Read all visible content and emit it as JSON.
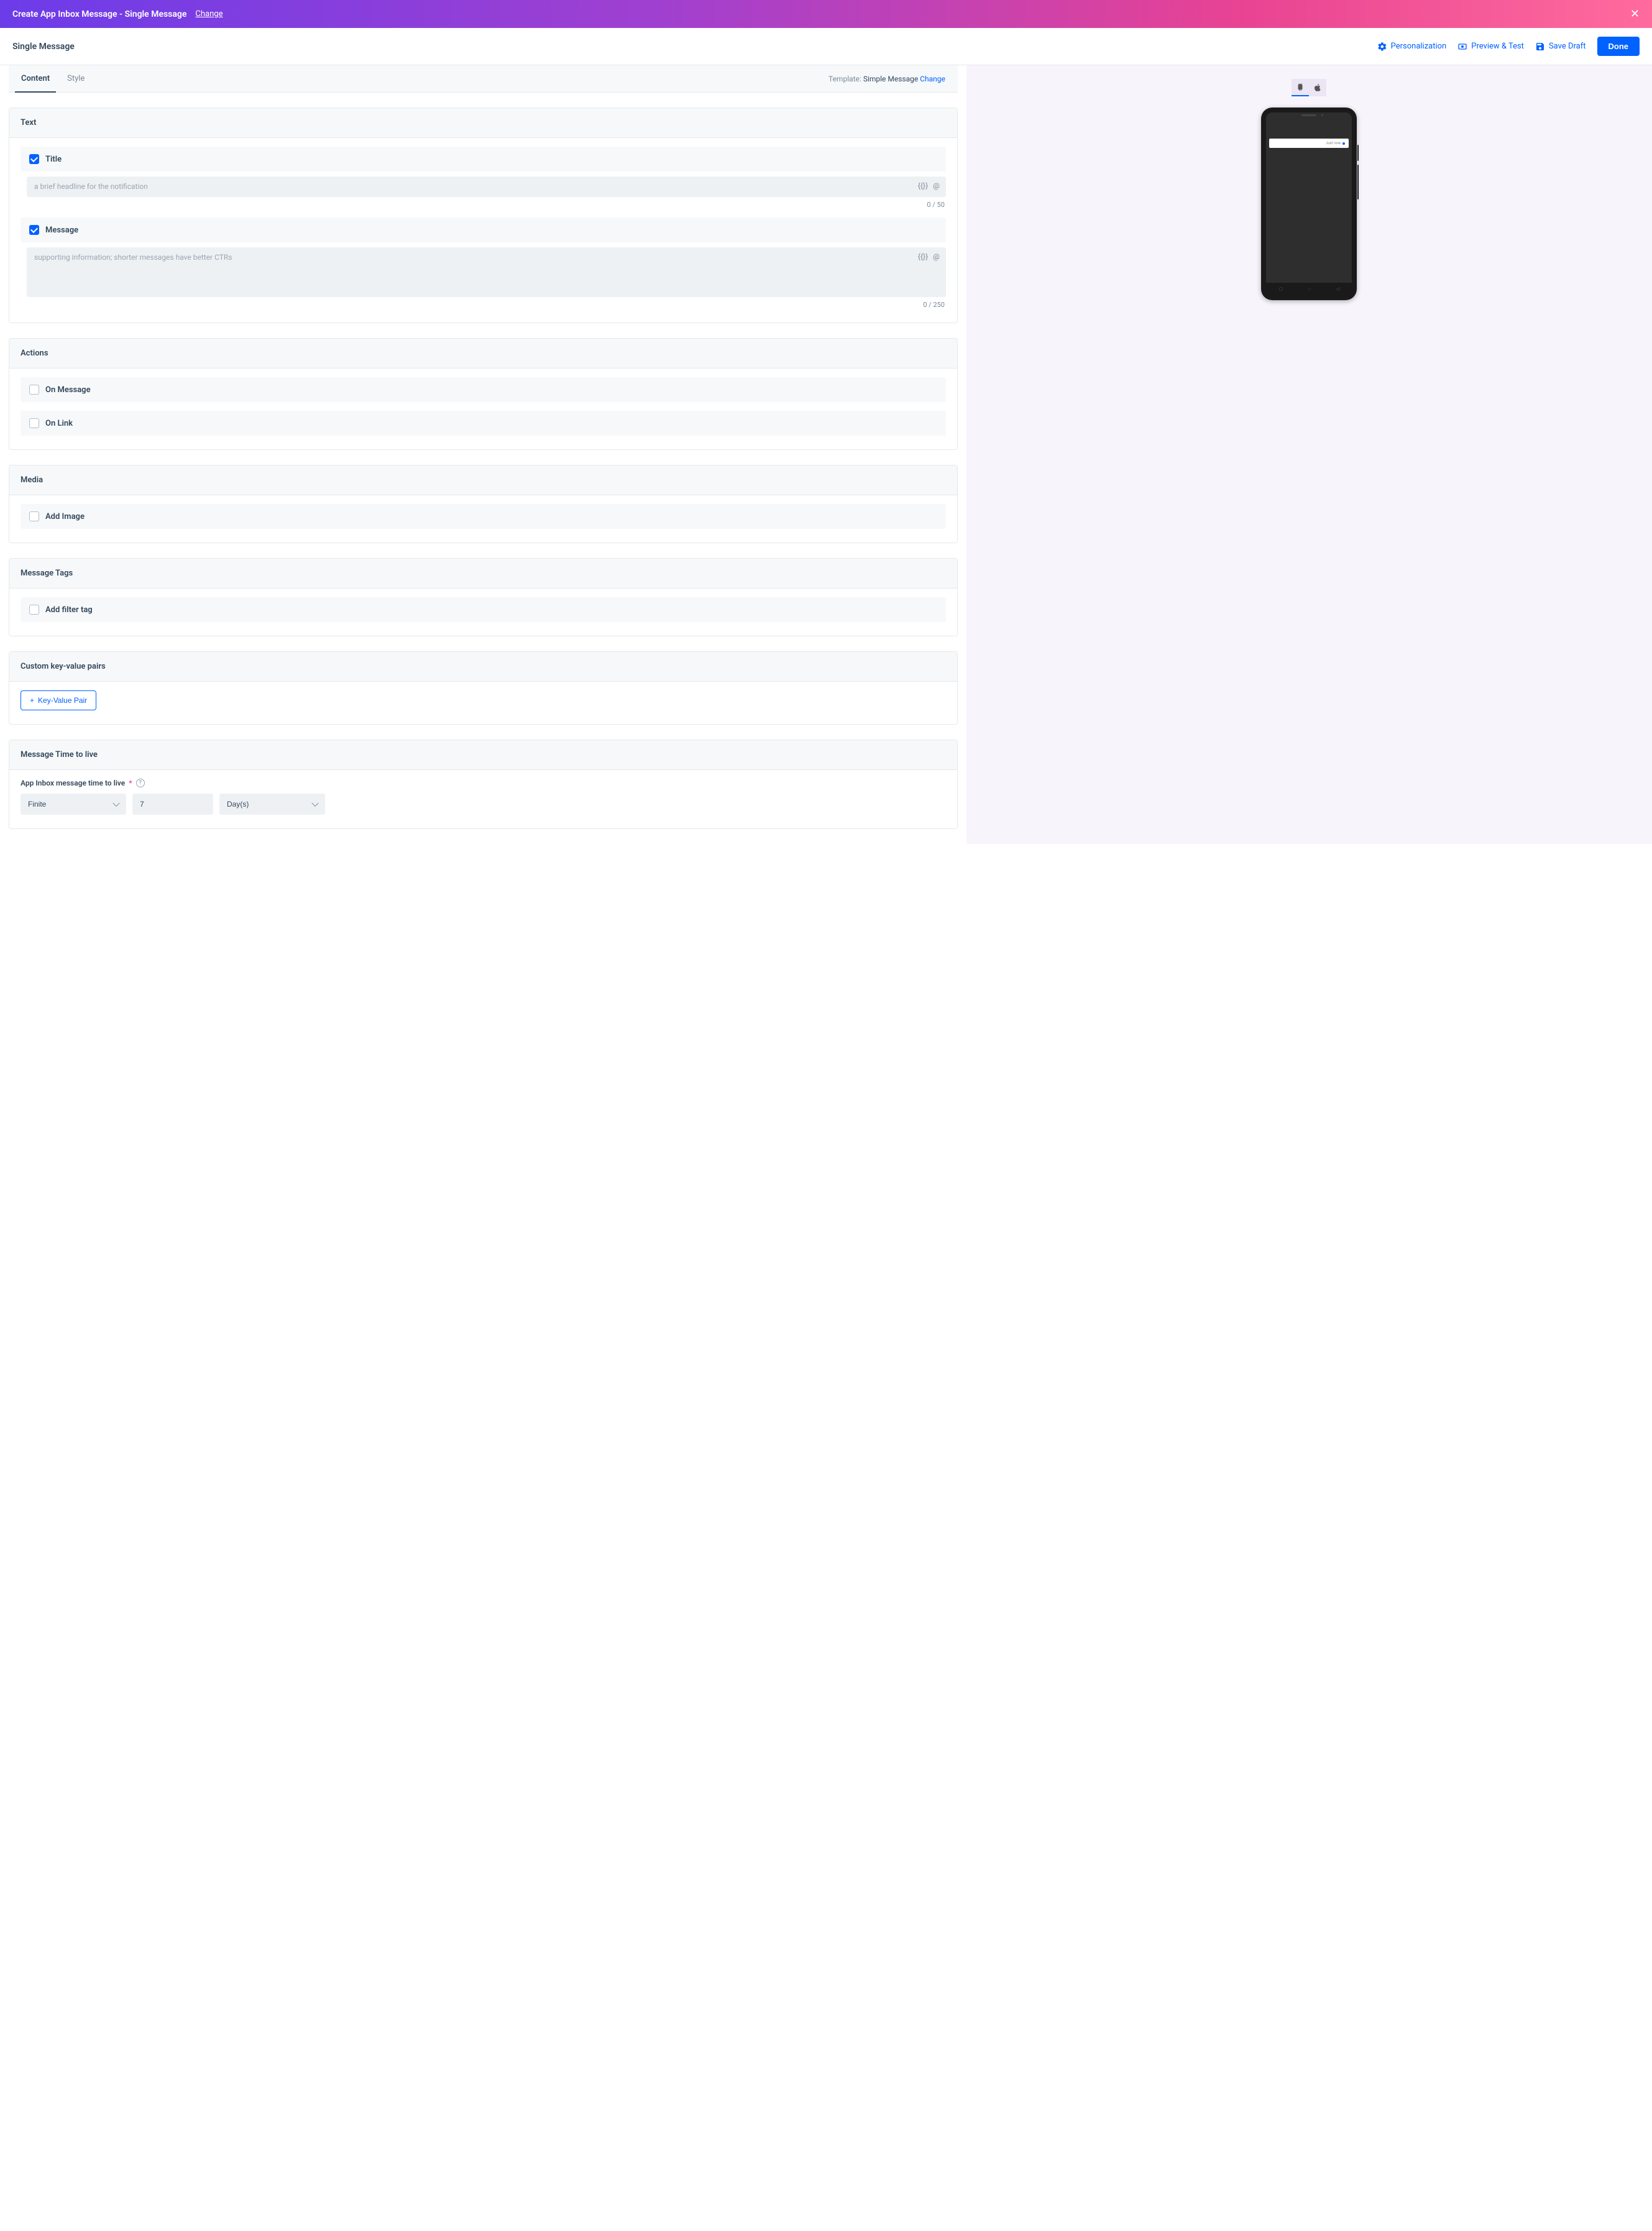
{
  "banner": {
    "title": "Create App Inbox Message - Single Message",
    "change": "Change"
  },
  "subheader": {
    "title": "Single Message",
    "personalization": "Personalization",
    "preview_test": "Preview & Test",
    "save_draft": "Save Draft",
    "done": "Done"
  },
  "tabs": {
    "content": "Content",
    "style": "Style",
    "template_label": "Template:",
    "template_value": "Simple Message",
    "template_change": "Change"
  },
  "sections": {
    "text": {
      "header": "Text",
      "title": {
        "label": "Title",
        "placeholder": "a brief headline for the notification",
        "counter": "0 / 50"
      },
      "message": {
        "label": "Message",
        "placeholder": "supporting information; shorter messages have better CTRs",
        "counter": "0 / 250"
      },
      "brace_icon": "{{}}",
      "at_icon": "@"
    },
    "actions": {
      "header": "Actions",
      "on_message": "On Message",
      "on_link": "On Link"
    },
    "media": {
      "header": "Media",
      "add_image": "Add Image"
    },
    "tags": {
      "header": "Message Tags",
      "add_filter": "Add filter tag"
    },
    "kv": {
      "header": "Custom key-value pairs",
      "button": "Key-Value Pair"
    },
    "ttl": {
      "header": "Message Time to live",
      "label": "App Inbox message time to live",
      "select_finite": "Finite",
      "value": "7",
      "unit": "Day(s)"
    }
  },
  "preview": {
    "just_now": "Just now"
  }
}
